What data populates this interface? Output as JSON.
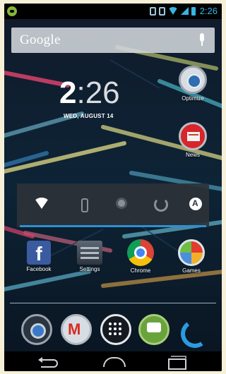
{
  "status_bar": {
    "time": "2:26",
    "icons": [
      "android-notification-icon",
      "screenshot-icon",
      "sim-icon",
      "wifi-icon",
      "signal-icon",
      "battery-icon"
    ],
    "accent_color": "#35b5e5"
  },
  "search": {
    "label": "Google",
    "icon": "mic-icon"
  },
  "clock": {
    "hours": "2",
    "minutes": ":26",
    "date": "WED, AUGUST 14"
  },
  "desktop_apps": [
    {
      "label": "Optimize",
      "icon": "optimize-icon"
    },
    {
      "label": "News",
      "icon": "news-icon"
    }
  ],
  "power_widget": {
    "toggles": [
      "wifi-toggle",
      "bluetooth-toggle",
      "gps-toggle",
      "sync-toggle",
      "brightness-toggle"
    ],
    "active_color": "#2f8fd0"
  },
  "home_apps": [
    {
      "label": "Facebook",
      "icon": "facebook-icon"
    },
    {
      "label": "Settings",
      "icon": "settings-icon"
    },
    {
      "label": "Chrome",
      "icon": "chrome-icon"
    },
    {
      "label": "Games",
      "icon": "games-icon"
    }
  ],
  "dock": [
    "camera-icon",
    "gmail-icon",
    "app-drawer-icon",
    "talk-icon",
    "phone-icon"
  ],
  "nav": [
    "back-button",
    "home-button",
    "recent-apps-button"
  ]
}
